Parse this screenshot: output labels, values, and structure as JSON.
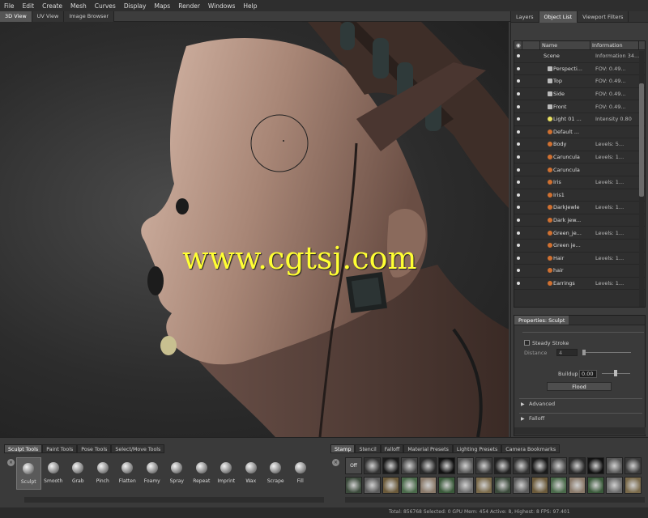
{
  "menu": [
    "File",
    "Edit",
    "Create",
    "Mesh",
    "Curves",
    "Display",
    "Maps",
    "Render",
    "Windows",
    "Help"
  ],
  "viewport_tabs": [
    "3D View",
    "UV View",
    "Image Browser"
  ],
  "watermark": "www.cgtsj.com",
  "right_tabs": [
    "Layers",
    "Object List",
    "Viewport Filters"
  ],
  "outliner": {
    "headers": [
      "Name",
      "Information"
    ],
    "rows": [
      {
        "name": "Scene",
        "info": "Information 34..."
      },
      {
        "name": "Perspecti...",
        "info": "FOV: 0.49..."
      },
      {
        "name": "Top",
        "info": "FOV: 0.49..."
      },
      {
        "name": "Side",
        "info": "FOV: 0.49..."
      },
      {
        "name": "Front",
        "info": "FOV: 0.49..."
      },
      {
        "name": "Light 01 ...",
        "info": "Intensity 0.80"
      },
      {
        "name": "Default ...",
        "info": ""
      },
      {
        "name": "Body",
        "info": "Levels: 5..."
      },
      {
        "name": "Caruncula",
        "info": "Levels: 1..."
      },
      {
        "name": "Caruncula",
        "info": ""
      },
      {
        "name": "Iris",
        "info": "Levels: 1..."
      },
      {
        "name": "Iris1",
        "info": ""
      },
      {
        "name": "DarkJewle",
        "info": "Levels: 1..."
      },
      {
        "name": "Dark jew...",
        "info": ""
      },
      {
        "name": "Green_je...",
        "info": "Levels: 1..."
      },
      {
        "name": "Green je...",
        "info": ""
      },
      {
        "name": "Hair",
        "info": "Levels: 1..."
      },
      {
        "name": "hair",
        "info": ""
      },
      {
        "name": "Earrings",
        "info": "Levels: 1..."
      }
    ]
  },
  "properties": {
    "tab": "Properties: Sculpt",
    "steady_stroke": "Steady Stroke",
    "distance_label": "Distance",
    "distance_value": "4",
    "buildup_label": "Buildup",
    "buildup_value": "0.00",
    "flood_label": "Flood",
    "advanced": "Advanced",
    "falloff": "Falloff"
  },
  "bottom_tabs": [
    "Sculpt Tools",
    "Paint Tools",
    "Pose Tools",
    "Select/Move Tools"
  ],
  "tools": [
    "Sculpt",
    "Smooth",
    "Grab",
    "Pinch",
    "Flatten",
    "Foamy",
    "Spray",
    "Repeat",
    "Imprint",
    "Wax",
    "Scrape",
    "Fill"
  ],
  "stamp_tabs": [
    "Stamp",
    "Stencil",
    "Falloff",
    "Material Presets",
    "Lighting Presets",
    "Camera Bookmarks"
  ],
  "stamp_off_label": "Off",
  "status": "Total: 856768  Selected: 0  GPU Mem: 454  Active: 8, Highest: 8  FPS: 97.401"
}
